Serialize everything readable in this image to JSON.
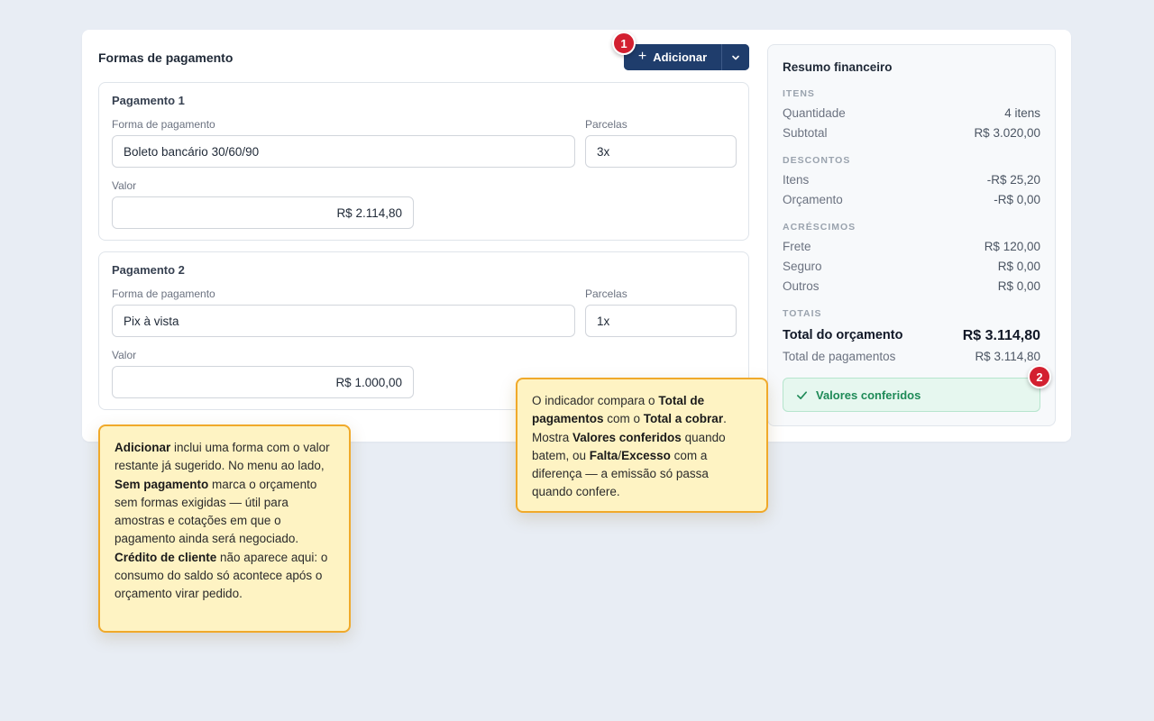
{
  "payments_section": {
    "title": "Formas de pagamento",
    "add_button": {
      "label": "Adicionar",
      "icon": "plus-icon"
    },
    "split_icon": "chevron-down-icon"
  },
  "payments": [
    {
      "title": "Pagamento 1",
      "method_label": "Forma de pagamento",
      "method_value": "Boleto bancário 30/60/90",
      "installments_label": "Parcelas",
      "installments_value": "3x",
      "amount_label": "Valor",
      "amount_value": "R$ 2.114,80"
    },
    {
      "title": "Pagamento 2",
      "method_label": "Forma de pagamento",
      "method_value": "Pix à vista",
      "installments_label": "Parcelas",
      "installments_value": "1x",
      "amount_label": "Valor",
      "amount_value": "R$ 1.000,00"
    }
  ],
  "summary": {
    "title": "Resumo financeiro",
    "sections": {
      "items": "ITENS",
      "discounts": "DESCONTOS",
      "additions": "ACRÉSCIMOS",
      "totals": "TOTAIS"
    },
    "rows": {
      "quantity": {
        "label": "Quantidade",
        "value": "4 itens"
      },
      "subtotal": {
        "label": "Subtotal",
        "value": "R$ 3.020,00"
      },
      "disc_items": {
        "label": "Itens",
        "value": "-R$ 25,20"
      },
      "disc_budget": {
        "label": "Orçamento",
        "value": "-R$ 0,00"
      },
      "freight": {
        "label": "Frete",
        "value": "R$ 120,00"
      },
      "insurance": {
        "label": "Seguro",
        "value": "R$ 0,00"
      },
      "others": {
        "label": "Outros",
        "value": "R$ 0,00"
      },
      "budget_total": {
        "label": "Total do orçamento",
        "value": "R$ 3.114,80"
      },
      "payments_total": {
        "label": "Total de pagamentos",
        "value": "R$ 3.114,80"
      }
    },
    "status": {
      "label": "Valores conferidos",
      "icon": "check-icon",
      "color": "#1e8a57"
    }
  },
  "badges": {
    "one": "1",
    "two": "2"
  },
  "notes": {
    "left": [
      {
        "b": true,
        "t": "Adicionar"
      },
      {
        "b": false,
        "t": " inclui uma forma com o valor restante já sugerido. No menu ao lado, "
      },
      {
        "b": true,
        "t": "Sem pagamento"
      },
      {
        "b": false,
        "t": " marca o orçamento sem formas exigidas — útil para amostras e cotações em que o pagamento ainda será negociado. "
      },
      {
        "b": true,
        "t": "Crédito de cliente"
      },
      {
        "b": false,
        "t": " não aparece aqui: o consumo do saldo só acontece após o orçamento virar pedido."
      }
    ],
    "right": [
      {
        "b": false,
        "t": "O indicador compara o "
      },
      {
        "b": true,
        "t": "Total de pagamentos"
      },
      {
        "b": false,
        "t": " com o "
      },
      {
        "b": true,
        "t": "Total a cobrar"
      },
      {
        "b": false,
        "t": ". Mostra "
      },
      {
        "b": true,
        "t": "Valores conferidos"
      },
      {
        "b": false,
        "t": " quando batem, ou "
      },
      {
        "b": true,
        "t": "Falta"
      },
      {
        "b": false,
        "t": "/"
      },
      {
        "b": true,
        "t": "Excesso"
      },
      {
        "b": false,
        "t": " com a diferença — a emissão só passa quando confere."
      }
    ]
  },
  "colors": {
    "primary": "#1f3d6c",
    "badge": "#d32030",
    "note_bg": "#fef3c3",
    "note_border": "#f0a92a",
    "success_bg": "#e6f7ef"
  }
}
